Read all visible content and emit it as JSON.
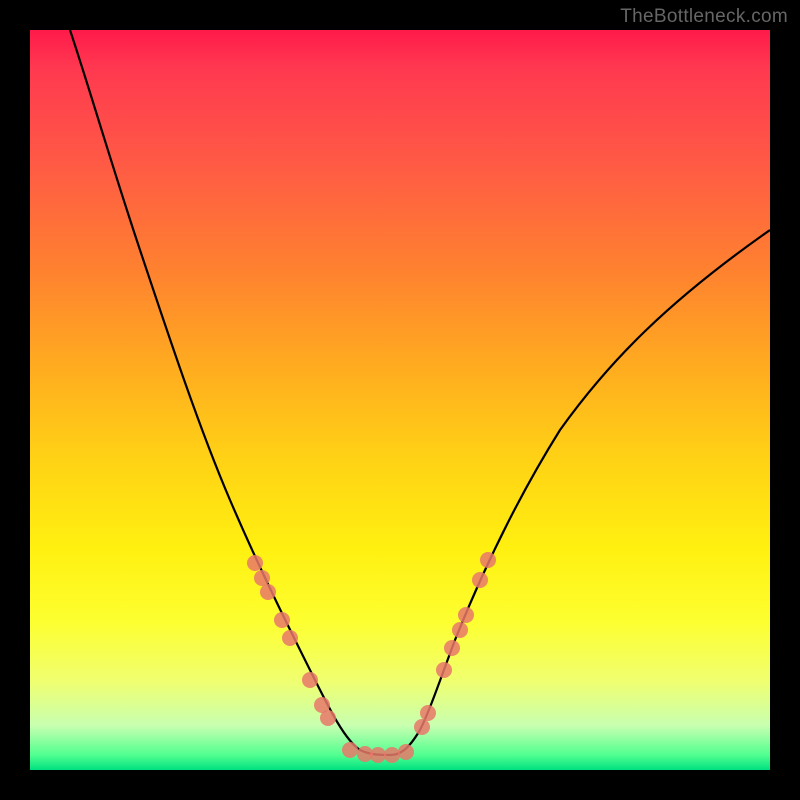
{
  "watermark": "TheBottleneck.com",
  "chart_data": {
    "type": "line",
    "title": "",
    "xlabel": "",
    "ylabel": "",
    "xlim": [
      0,
      100
    ],
    "ylim": [
      0,
      100
    ],
    "background_gradient": {
      "top": "#ff1a4a",
      "middle": "#ffd215",
      "bottom": "#00e080"
    },
    "series": [
      {
        "name": "bottleneck-curve",
        "type": "line",
        "color": "#000000",
        "x": [
          5,
          10,
          15,
          20,
          25,
          30,
          35,
          40,
          42,
          44,
          46,
          48,
          50,
          52,
          55,
          60,
          65,
          70,
          75,
          80,
          85,
          90,
          95,
          100
        ],
        "y": [
          100,
          85,
          70,
          55,
          42,
          30,
          20,
          12,
          8,
          5,
          3,
          3,
          3,
          5,
          10,
          18,
          28,
          36,
          44,
          50,
          56,
          61,
          65,
          68
        ]
      },
      {
        "name": "highlight-dots",
        "type": "scatter",
        "color": "#e8786a",
        "x": [
          31,
          32,
          34,
          35,
          37,
          39,
          40,
          41,
          43,
          45,
          47,
          49,
          51,
          52,
          53,
          54,
          56,
          57,
          58
        ],
        "y": [
          28,
          26,
          22,
          19,
          15,
          10,
          8,
          6,
          4,
          3,
          3,
          3,
          4,
          6,
          10,
          14,
          18,
          22,
          26
        ]
      }
    ]
  }
}
